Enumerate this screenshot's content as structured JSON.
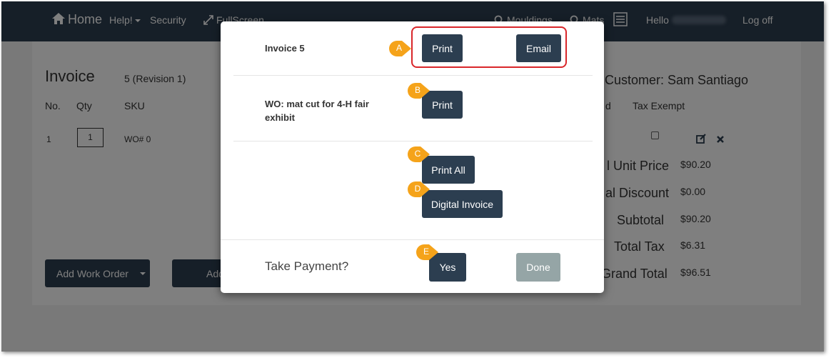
{
  "nav": {
    "home": "Home",
    "help": "Help!",
    "security": "Security",
    "fullscreen": "FullScreen",
    "mouldings": "Mouldings",
    "mats": "Mats",
    "hello": "Hello",
    "logoff": "Log off"
  },
  "invoice": {
    "title": "Invoice",
    "revision": "5 (Revision 1)",
    "customer_label": "Customer:",
    "customer_name": "Sam Santiago",
    "columns": [
      "No.",
      "Qty",
      "SKU"
    ],
    "col_d_partial": "d",
    "tax_exempt": "Tax Exempt",
    "row": {
      "no": "1",
      "qty": "1",
      "sku": "WO# 0"
    },
    "totals": [
      {
        "label": "l Unit Price",
        "value": "$90.20"
      },
      {
        "label": "al Discount",
        "value": "$0.00"
      },
      {
        "label": "Subtotal",
        "value": "$90.20"
      },
      {
        "label": "Total Tax",
        "value": "$6.31"
      },
      {
        "label": "Grand Total",
        "value": "$96.51"
      }
    ],
    "add_work_order": "Add Work Order",
    "add_partial": "Add"
  },
  "modal": {
    "invoice_label": "Invoice 5",
    "print_label": "Print",
    "email_label": "Email",
    "wo_label": "WO: mat cut for 4-H fair exhibit",
    "wo_print_label": "Print",
    "print_all_label": "Print All",
    "digital_invoice_label": "Digital Invoice",
    "take_payment_label": "Take Payment?",
    "yes_label": "Yes",
    "done_label": "Done"
  },
  "callouts": {
    "a": "A",
    "b": "B",
    "c": "C",
    "d": "D",
    "e": "E"
  },
  "colors": {
    "navbar": "#2c3e50",
    "button": "#2c3e50",
    "button_disabled": "#95a5a6",
    "callout": "#f5a31a",
    "highlight": "#d9262a"
  },
  "icons": [
    "home-icon",
    "chevron-down-icon",
    "expand-icon",
    "search-icon",
    "list-icon",
    "checkbox-icon",
    "edit-icon",
    "close-icon"
  ]
}
